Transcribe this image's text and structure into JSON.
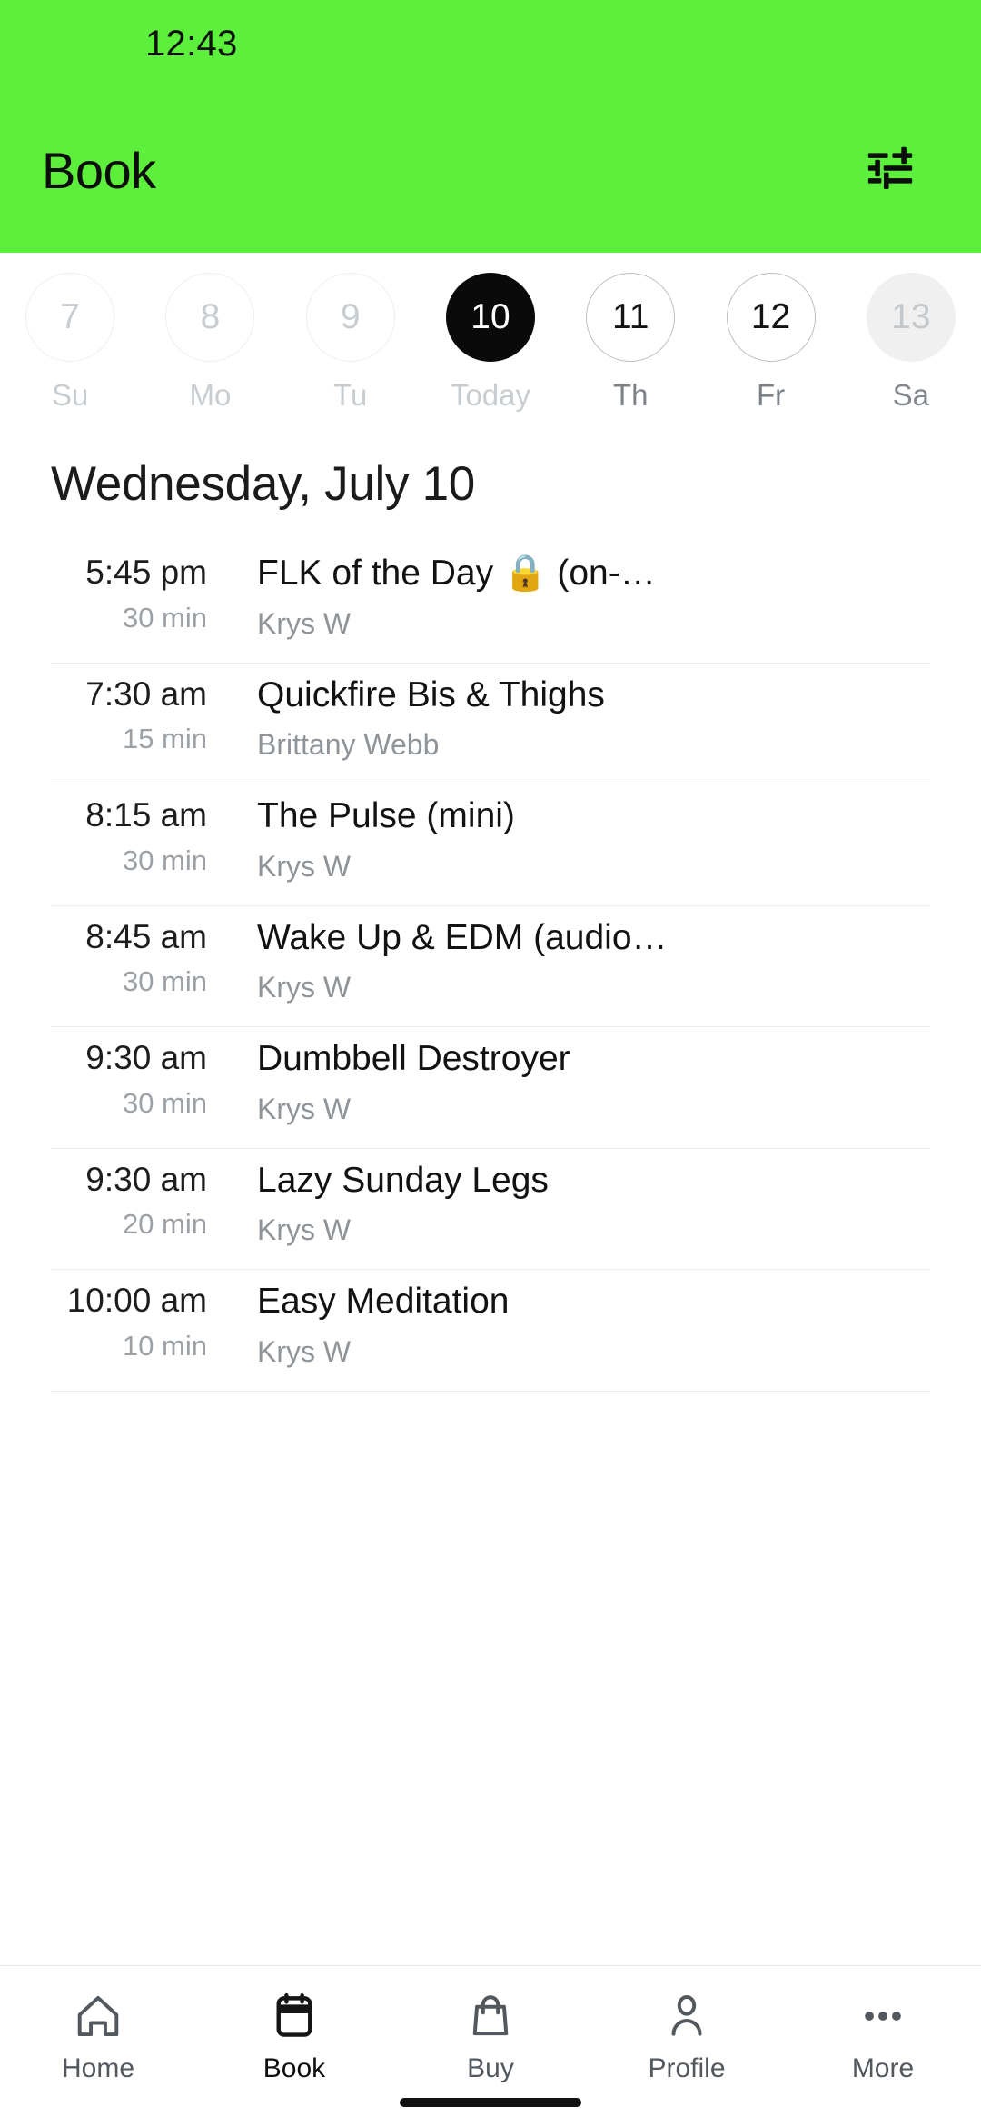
{
  "statusbar": {
    "time": "12:43"
  },
  "header": {
    "title": "Book",
    "background_color": "#5CEF3C",
    "filter_icon": "tune-filter-icon"
  },
  "datestrip": {
    "days": [
      {
        "number": "7",
        "label": "Su",
        "state": "past"
      },
      {
        "number": "8",
        "label": "Mo",
        "state": "past"
      },
      {
        "number": "9",
        "label": "Tu",
        "state": "past"
      },
      {
        "number": "10",
        "label": "Today",
        "state": "selected"
      },
      {
        "number": "11",
        "label": "Th",
        "state": "available"
      },
      {
        "number": "12",
        "label": "Fr",
        "state": "available"
      },
      {
        "number": "13",
        "label": "Sa",
        "state": "filled"
      }
    ]
  },
  "schedule": {
    "heading": "Wednesday, July 10",
    "classes": [
      {
        "time": "5:45 pm",
        "duration": "30 min",
        "title": "FLK of the Day 🔒 (on-dem…",
        "instructor": "Krys W"
      },
      {
        "time": "7:30 am",
        "duration": "15 min",
        "title": "Quickfire Bis & Thighs",
        "instructor": "Brittany Webb"
      },
      {
        "time": "8:15 am",
        "duration": "30 min",
        "title": "The Pulse (mini)",
        "instructor": "Krys W"
      },
      {
        "time": "8:45 am",
        "duration": "30 min",
        "title": "Wake Up & EDM (audio-…",
        "instructor": "Krys W"
      },
      {
        "time": "9:30 am",
        "duration": "30 min",
        "title": "Dumbbell Destroyer",
        "instructor": "Krys W"
      },
      {
        "time": "9:30 am",
        "duration": "20 min",
        "title": "Lazy Sunday Legs",
        "instructor": "Krys W"
      },
      {
        "time": "10:00 am",
        "duration": "10 min",
        "title": "Easy Meditation",
        "instructor": "Krys W"
      }
    ]
  },
  "bottom_nav": {
    "items": [
      {
        "label": "Home",
        "icon": "home-icon",
        "active": false
      },
      {
        "label": "Book",
        "icon": "calendar-icon",
        "active": true
      },
      {
        "label": "Buy",
        "icon": "bag-icon",
        "active": false
      },
      {
        "label": "Profile",
        "icon": "person-icon",
        "active": false
      },
      {
        "label": "More",
        "icon": "ellipsis-icon",
        "active": false
      }
    ]
  }
}
